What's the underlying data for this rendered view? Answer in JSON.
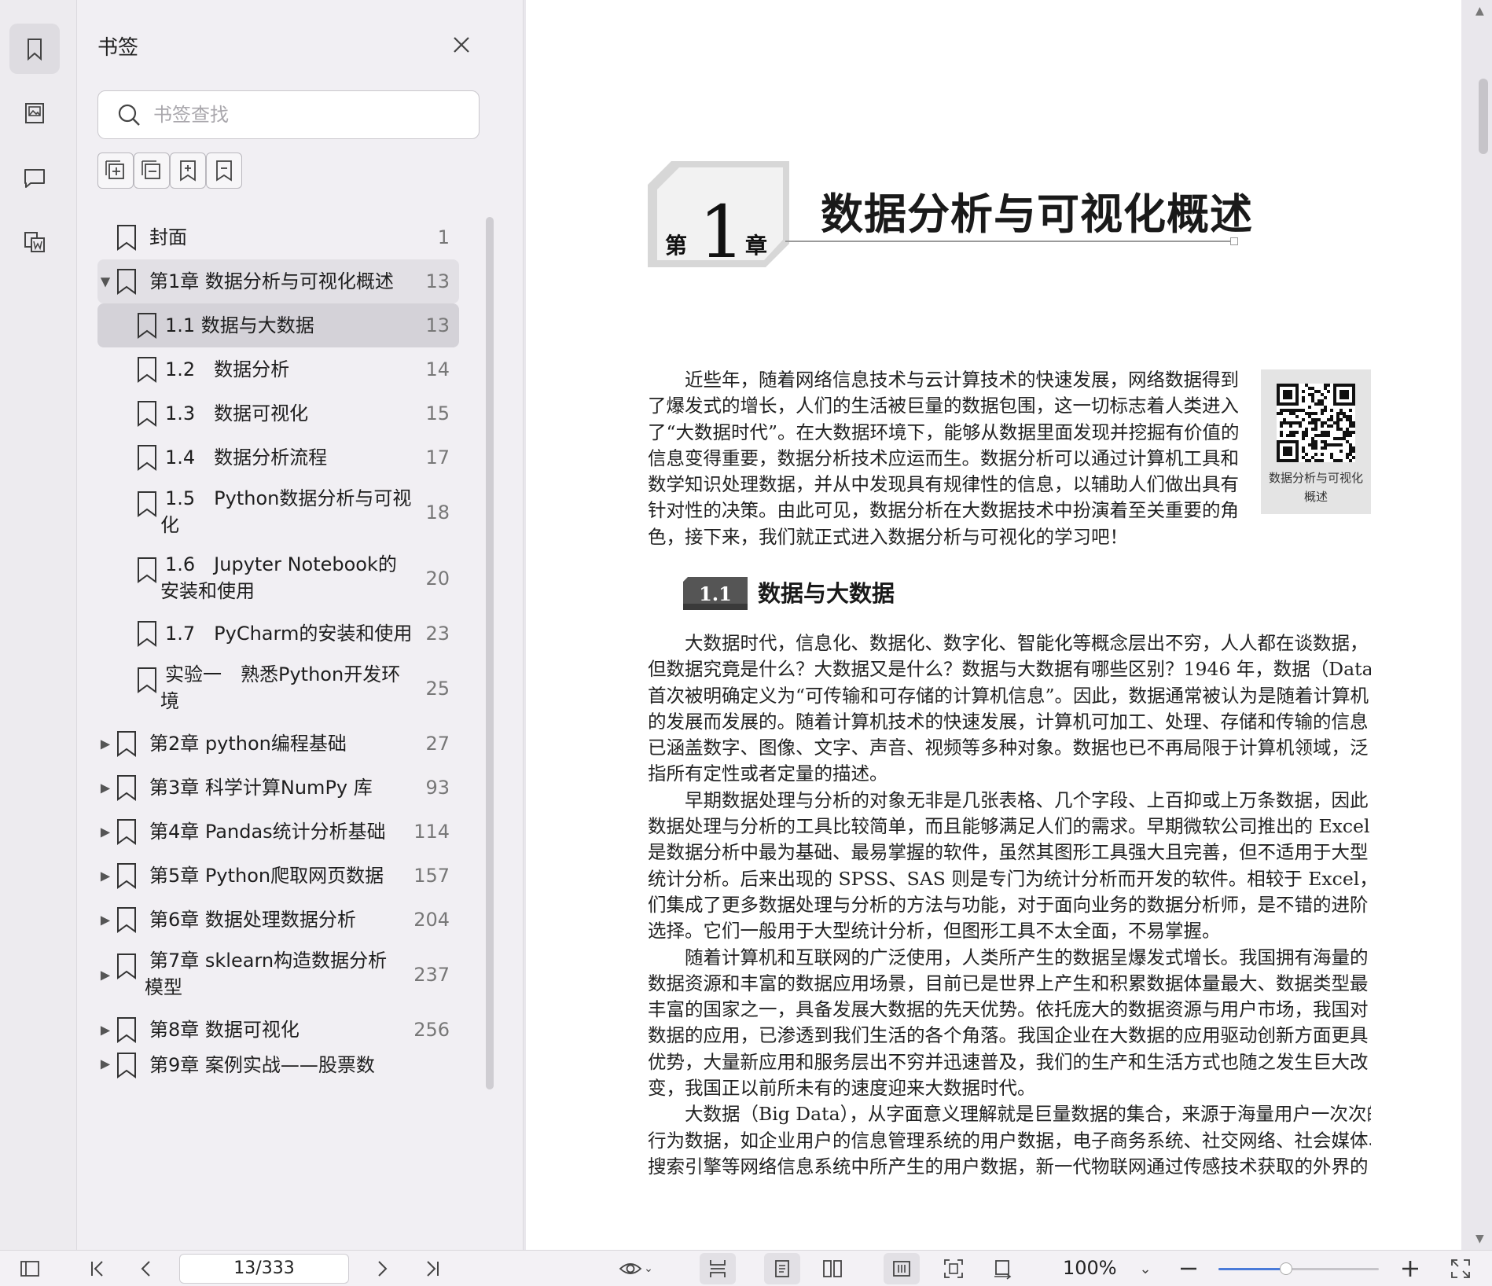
{
  "panel": {
    "title": "书签",
    "search_placeholder": "书签查找"
  },
  "bookmarks": [
    {
      "label": "封面",
      "page": "1",
      "level": 0,
      "caret": "",
      "state": ""
    },
    {
      "label": "第1章 数据分析与可视化概述",
      "page": "13",
      "level": 0,
      "caret": "▼",
      "state": "expanded"
    },
    {
      "label": "1.1 数据与大数据",
      "page": "13",
      "level": 1,
      "caret": "",
      "state": "selected"
    },
    {
      "label": "1.2　数据分析",
      "page": "14",
      "level": 1,
      "caret": "",
      "state": ""
    },
    {
      "label": "1.3　数据可视化",
      "page": "15",
      "level": 1,
      "caret": "",
      "state": ""
    },
    {
      "label": "1.4　数据分析流程",
      "page": "17",
      "level": 1,
      "caret": "",
      "state": ""
    },
    {
      "label": "1.5　Python数据分析与可视化",
      "label_lines": [
        "1.5　Python数据分析与可视",
        "化"
      ],
      "page": "18",
      "level": 1,
      "caret": "",
      "state": ""
    },
    {
      "label": "1.6　Jupyter Notebook的安装和使用",
      "label_lines": [
        "1.6　Jupyter Notebook的",
        "安装和使用"
      ],
      "page": "20",
      "level": 1,
      "caret": "",
      "state": ""
    },
    {
      "label": "1.7　PyCharm的安装和使用",
      "page": "23",
      "level": 1,
      "caret": "",
      "state": ""
    },
    {
      "label": "实验一　熟悉Python开发环境",
      "label_lines": [
        " 实验一　熟悉Python开发环",
        "境"
      ],
      "page": "25",
      "level": 1,
      "caret": "",
      "state": ""
    },
    {
      "label": "第2章 python编程基础",
      "page": "27",
      "level": 0,
      "caret": "▶",
      "state": ""
    },
    {
      "label": "第3章 科学计算NumPy 库",
      "page": "93",
      "level": 0,
      "caret": "▶",
      "state": ""
    },
    {
      "label": "第4章 Pandas统计分析基础",
      "page": "114",
      "level": 0,
      "caret": "▶",
      "state": ""
    },
    {
      "label": "第5章 Python爬取网页数据",
      "page": "157",
      "level": 0,
      "caret": "▶",
      "state": ""
    },
    {
      "label": "第6章 数据处理数据分析",
      "page": "204",
      "level": 0,
      "caret": "▶",
      "state": ""
    },
    {
      "label": "第7章 sklearn构造数据分析模型",
      "label_lines": [
        "第7章 sklearn构造数据分析",
        "模型"
      ],
      "page": "237",
      "level": 0,
      "caret": "▶",
      "state": ""
    },
    {
      "label": "第8章 数据可视化",
      "page": "256",
      "level": 0,
      "caret": "▶",
      "state": ""
    },
    {
      "label": "第9章 案例实战——股票数",
      "page": "",
      "level": 0,
      "caret": "▶",
      "state": "cut"
    }
  ],
  "document": {
    "chapter_prefix": "第",
    "chapter_number": "1",
    "chapter_suffix": "章",
    "chapter_title": "数据分析与可视化概述",
    "qr_caption_line1": "数据分析与可视化",
    "qr_caption_line2": "概述",
    "intro_lines": [
      "近些年，随着网络信息技术与云计算技术的快速发展，网络数据得到",
      "了爆发式的增长，人们的生活被巨量的数据包围，这一切标志着人类进入",
      "了“大数据时代”。在大数据环境下，能够从数据里面发现并挖掘有价值的",
      "信息变得重要，数据分析技术应运而生。数据分析可以通过计算机工具和",
      "数学知识处理数据，并从中发现具有规律性的信息，以辅助人们做出具有",
      "针对性的决策。由此可见，数据分析在大数据技术中扮演着至关重要的角",
      "色，接下来，我们就正式进入数据分析与可视化的学习吧！"
    ],
    "section_number": "1.1",
    "section_title": "数据与大数据",
    "body_lines": [
      {
        "indent": true,
        "text": "大数据时代，信息化、数据化、数字化、智能化等概念层出不穷，人人都在谈数据，"
      },
      {
        "indent": false,
        "text": "但数据究竟是什么？大数据又是什么？数据与大数据有哪些区别？1946 年，数据（Data）"
      },
      {
        "indent": false,
        "text": "首次被明确定义为“可传输和可存储的计算机信息”。因此，数据通常被认为是随着计算机"
      },
      {
        "indent": false,
        "text": "的发展而发展的。随着计算机技术的快速发展，计算机可加工、处理、存储和传输的信息"
      },
      {
        "indent": false,
        "text": "已涵盖数字、图像、文字、声音、视频等多种对象。数据也已不再局限于计算机领域，泛"
      },
      {
        "indent": false,
        "text": "指所有定性或者定量的描述。"
      },
      {
        "indent": true,
        "text": "早期数据处理与分析的对象无非是几张表格、几个字段、上百抑或上万条数据，因此"
      },
      {
        "indent": false,
        "text": "数据处理与分析的工具比较简单，而且能够满足人们的需求。早期微软公司推出的 Excel，"
      },
      {
        "indent": false,
        "text": "是数据分析中最为基础、最易掌握的软件，虽然其图形工具强大且完善，但不适用于大型"
      },
      {
        "indent": false,
        "text": "统计分析。后来出现的 SPSS、SAS 则是专门为统计分析而开发的软件。相较于 Excel，它"
      },
      {
        "indent": false,
        "text": "们集成了更多数据处理与分析的方法与功能，对于面向业务的数据分析师，是不错的进阶"
      },
      {
        "indent": false,
        "text": "选择。它们一般用于大型统计分析，但图形工具不太全面，不易掌握。"
      },
      {
        "indent": true,
        "text": "随着计算机和互联网的广泛使用，人类所产生的数据呈爆发式增长。我国拥有海量的"
      },
      {
        "indent": false,
        "text": "数据资源和丰富的数据应用场景，目前已是世界上产生和积累数据体量最大、数据类型最"
      },
      {
        "indent": false,
        "text": "丰富的国家之一，具备发展大数据的先天优势。依托庞大的数据资源与用户市场，我国对"
      },
      {
        "indent": false,
        "text": "数据的应用，已渗透到我们生活的各个角落。我国企业在大数据的应用驱动创新方面更具"
      },
      {
        "indent": false,
        "text": "优势，大量新应用和服务层出不穷并迅速普及，我们的生产和生活方式也随之发生巨大改"
      },
      {
        "indent": false,
        "text": "变，我国正以前所未有的速度迎来大数据时代。"
      },
      {
        "indent": true,
        "text": "大数据（Big Data），从字面意义理解就是巨量数据的集合，来源于海量用户一次次的"
      },
      {
        "indent": false,
        "text": "行为数据，如企业用户的信息管理系统的用户数据，电子商务系统、社交网络、社会媒体、"
      },
      {
        "indent": false,
        "text": "搜索引擎等网络信息系统中所产生的用户数据，新一代物联网通过传感技术获取的外界的"
      }
    ]
  },
  "bottombar": {
    "page_indicator": "13/333",
    "zoom_label": "100%",
    "zoom_fraction": 0.42
  }
}
